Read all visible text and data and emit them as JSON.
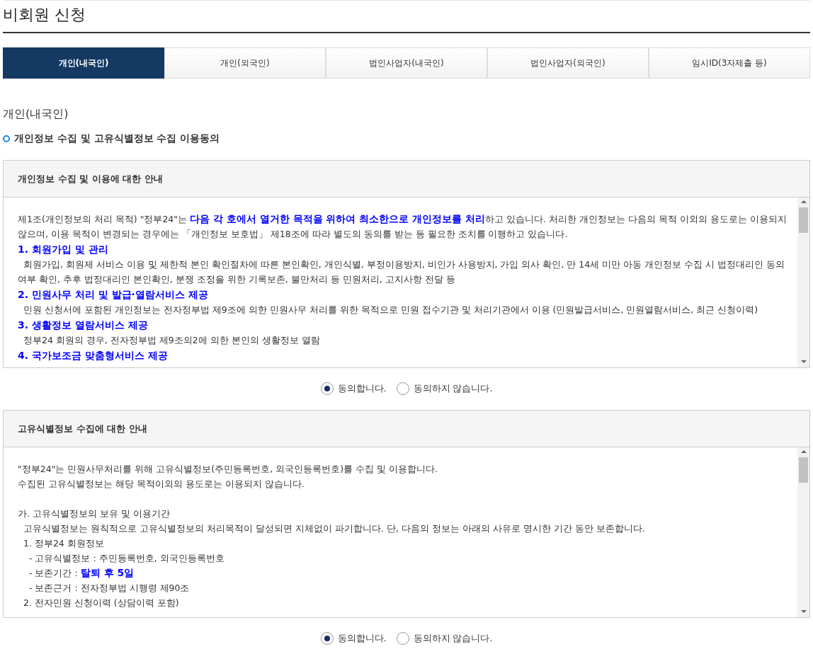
{
  "page_title": "비회원 신청",
  "tabs": [
    {
      "label": "개인(내국인)",
      "selected": true
    },
    {
      "label": "개인(외국인)",
      "selected": false
    },
    {
      "label": "법인사업자(내국인)",
      "selected": false
    },
    {
      "label": "법인사업자(외국인)",
      "selected": false
    },
    {
      "label": "임시ID(3자제출 등)",
      "selected": false
    }
  ],
  "section_title": "개인(내국인)",
  "subsection_title": "개인정보 수집 및 고유식별정보 수집 이용동의",
  "notices": [
    {
      "title": "개인정보 수집 및 이용에 대한 안내",
      "paragraphs": [
        {
          "kind": "text",
          "text": "제1조(개인정보의 처리 목적) \"정부24\"는 **다음 각 호에서 열거한 목적을 위하여 최소한으로 개인정보를 처리**하고 있습니다. 처리한 개인정보는 다음의 목적 이외의 용도로는 이용되지 않으며, 이용 목적이 변경되는 경우에는 「개인정보 보호법」 제18조에 따라 별도의 동의를 받는 등 필요한 조치를 이행하고 있습니다."
        },
        {
          "kind": "heading",
          "text": "1. 회원가입 및 관리"
        },
        {
          "kind": "item",
          "text": "회원가입, 회원제 서비스 이용 및 제한적 본인 확인절차에 따른 본인확인, 개인식별, 부정이용방지, 비인가 사용방지, 가입 의사 확인, 만 14세 미만 아동 개인정보 수집 시 법정대리인 동의여부 확인, 추후 법정대리인 본인확인, 분쟁 조정을 위한 기록보존, 불만처리 등 민원처리, 고지사항 전달 등"
        },
        {
          "kind": "heading",
          "text": "2. 민원사무 처리 및 발급·열람서비스 제공"
        },
        {
          "kind": "item",
          "text": "민원 신청서에 포함된 개인정보는 전자정부법 제9조에 의한 민원사무 처리를 위한 목적으로 민원 접수기관 및 처리기관에서 이용 (민원발급서비스, 민원열람서비스, 최근 신청이력)"
        },
        {
          "kind": "heading",
          "text": "3. 생활정보 열람서비스 제공"
        },
        {
          "kind": "item",
          "text": "정부24 회원의 경우, 전자정부법 제9조의2에 의한 본인의 생활정보 열람"
        },
        {
          "kind": "heading",
          "text": "4. 국가보조금 맞춤형서비스 제공"
        }
      ],
      "options": [
        {
          "label": "동의합니다.",
          "selected": true
        },
        {
          "label": "동의하지 않습니다.",
          "selected": false
        }
      ]
    },
    {
      "title": "고유식별정보 수집에 대한 안내",
      "paragraphs": [
        {
          "kind": "text",
          "text": "\"정부24\"는 민원사무처리를 위해 고유식별정보(주민등록번호, 외국인등록번호)를 수집 및 이용합니다."
        },
        {
          "kind": "text",
          "text": "수집된 고유식별정보는 해당 목적이외의 용도로는 이용되지 않습니다."
        },
        {
          "kind": "section",
          "text": "가. 고유식별정보의 보유 및 이용기간",
          "children": [
            {
              "text": "고유식별정보는 원칙적으로 고유식별정보의 처리목적이 달성되면 지체없이 파기합니다. 단, 다음의 정보는 아래의 사유로 명시한 기간 동안 보존합니다."
            },
            {
              "text": "1. 정부24 회원정보",
              "children": [
                {
                  "text": "- 고유식별정보 : 주민등록번호, 외국인등록번호"
                },
                {
                  "text": "- 보존기간 : **탈퇴 후 5일**"
                },
                {
                  "text": "- 보존근거 : 전자정부법 시행령 제90조"
                }
              ]
            },
            {
              "text": "2. 전자민원 신청이력 (상담이력 포함)"
            }
          ]
        }
      ],
      "options": [
        {
          "label": "동의합니다.",
          "selected": true
        },
        {
          "label": "동의하지 않습니다.",
          "selected": false
        }
      ]
    }
  ]
}
